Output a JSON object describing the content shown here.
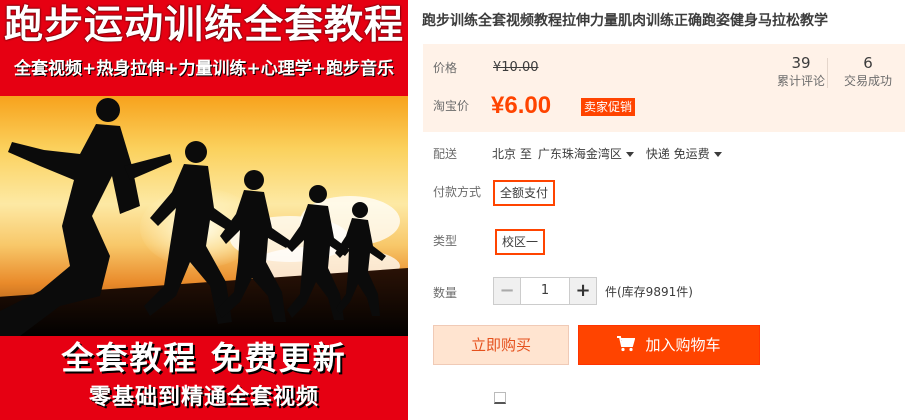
{
  "hero": {
    "title": "跑步运动训练全套教程",
    "subtitle": "全套视频+热身拉伸+力量训练+心理学+跑步音乐",
    "bottom_title": "全套教程  免费更新",
    "bottom_subtitle": "零基础到精通全套视频"
  },
  "product": {
    "title": "跑步训练全套视频教程拉伸力量肌肉训练正确跑姿健身马拉松教学"
  },
  "price": {
    "label": "价格",
    "old": "¥10.00",
    "taobao_label": "淘宝价",
    "current": "¥6.00",
    "promo_badge": "卖家促销"
  },
  "stats": [
    {
      "value": "39",
      "caption": "累计评论"
    },
    {
      "value": "6",
      "caption": "交易成功"
    }
  ],
  "shipping": {
    "label": "配送",
    "from": "北京 至",
    "to": "广东珠海金湾区",
    "method": "快递 免运费"
  },
  "payment": {
    "label": "付款方式",
    "option": "全额支付"
  },
  "type": {
    "label": "类型",
    "option": "校区一"
  },
  "quantity": {
    "label": "数量",
    "value": "1",
    "minus": "−",
    "plus": "+",
    "stock": "件(库存9891件)"
  },
  "actions": {
    "buy_now": "立即购买",
    "add_to_cart": "加入购物车"
  },
  "colors": {
    "accent": "#ff4400",
    "hero_red": "#e60012",
    "price_bg": "#fff2e8"
  }
}
